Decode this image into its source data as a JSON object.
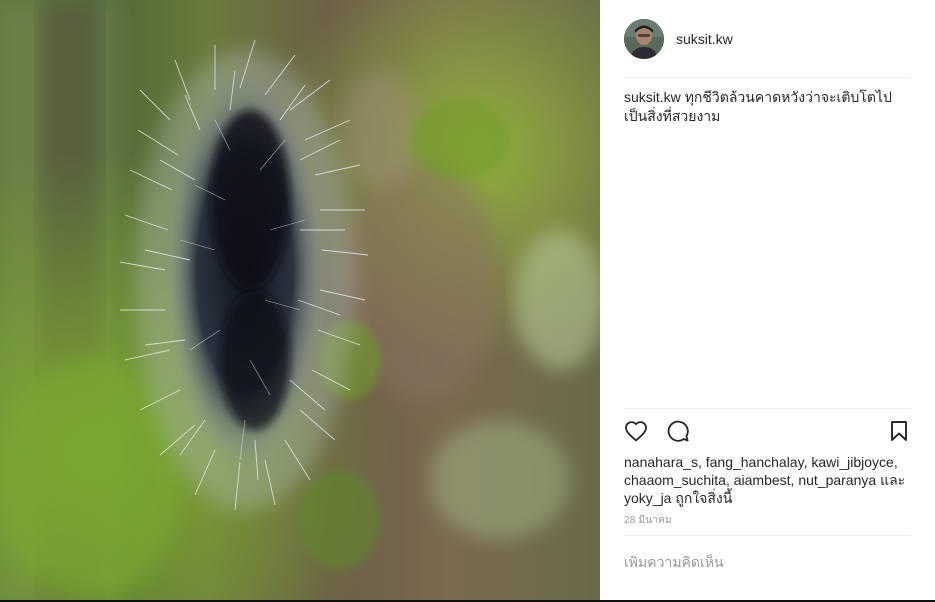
{
  "post": {
    "username": "suksit.kw",
    "caption": {
      "user": "suksit.kw",
      "text": "ทุกชีวิตล้วนคาดหวังว่าจะเติบโตไปเป็นสิ่งที่สวยงาม"
    },
    "likers": [
      "nanahara_s",
      "fang_hanchalay",
      "kawi_jibjoyce",
      "chaaom_suchita",
      "aiambest",
      "nut_paranya",
      "yoky_ja"
    ],
    "likes_separator": ", ",
    "likes_and": "และ",
    "likes_suffix": "ถูกใจสิ่งนี้",
    "date": "28 มีนาคม",
    "comment_placeholder": "เพิ่มความคิดเห็น"
  },
  "icons": {
    "like": "heart-icon",
    "comment": "comment-bubble-icon",
    "save": "bookmark-icon"
  },
  "colors": {
    "text": "#262626",
    "muted": "#999999",
    "divider": "#efefef",
    "photo_moss": "#6f8a2e",
    "photo_bark": "#7a6650",
    "caterpillar_dark": "#1d2530",
    "caterpillar_hair": "#e8eef2"
  }
}
